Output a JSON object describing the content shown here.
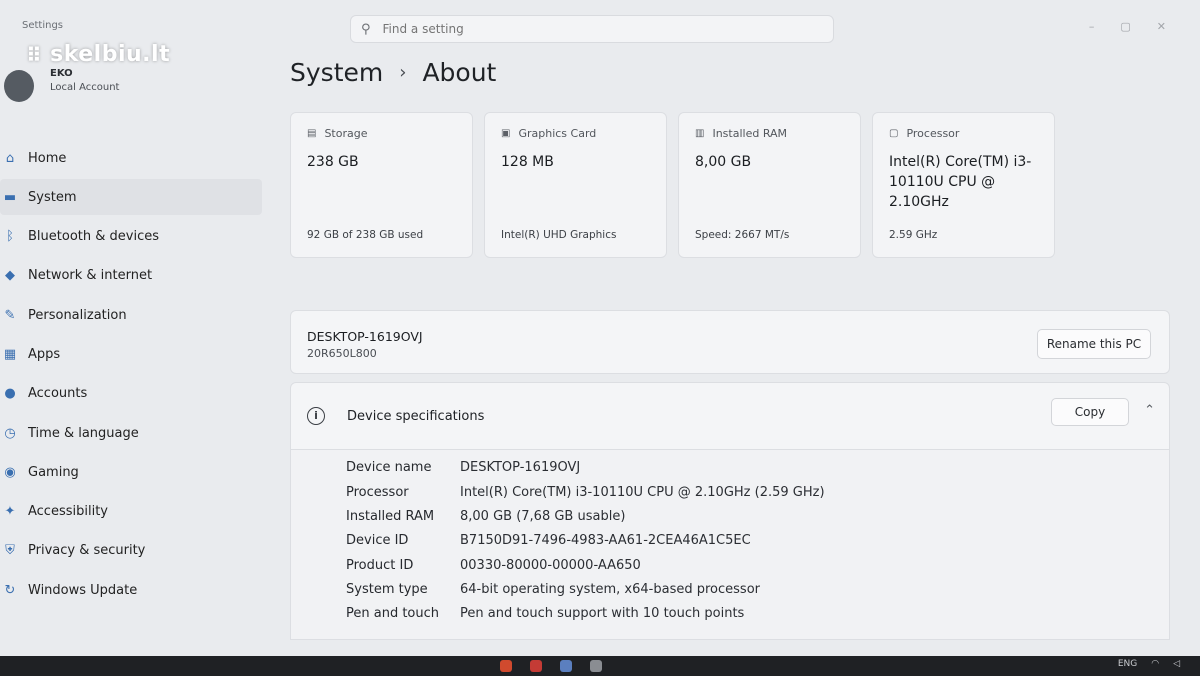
{
  "app": {
    "title": "Settings",
    "watermark": "skelbiu.lt",
    "window_controls": [
      "–",
      "▢",
      "✕"
    ]
  },
  "search": {
    "placeholder": "Find a setting"
  },
  "profile": {
    "name": "EKO",
    "account_type": "Local Account"
  },
  "nav": {
    "items": [
      {
        "label": "Home",
        "icon": "home-icon"
      },
      {
        "label": "System",
        "icon": "system-icon",
        "active": true
      },
      {
        "label": "Bluetooth & devices",
        "icon": "bluetooth-icon"
      },
      {
        "label": "Network & internet",
        "icon": "network-icon"
      },
      {
        "label": "Personalization",
        "icon": "brush-icon"
      },
      {
        "label": "Apps",
        "icon": "apps-icon"
      },
      {
        "label": "Accounts",
        "icon": "accounts-icon"
      },
      {
        "label": "Time & language",
        "icon": "clock-icon"
      },
      {
        "label": "Gaming",
        "icon": "gaming-icon"
      },
      {
        "label": "Accessibility",
        "icon": "accessibility-icon"
      },
      {
        "label": "Privacy & security",
        "icon": "shield-icon"
      },
      {
        "label": "Windows Update",
        "icon": "update-icon"
      }
    ]
  },
  "breadcrumb": {
    "parent": "System",
    "separator": "›",
    "current": "About"
  },
  "cards": [
    {
      "label": "Storage",
      "icon": "storage-icon",
      "value": "238 GB",
      "detail": "92 GB of 238 GB used"
    },
    {
      "label": "Graphics Card",
      "icon": "graphics-card-icon",
      "value": "128 MB",
      "detail": "Intel(R) UHD Graphics"
    },
    {
      "label": "Installed RAM",
      "icon": "ram-icon",
      "value": "8,00 GB",
      "detail": "Speed: 2667 MT/s"
    },
    {
      "label": "Processor",
      "icon": "processor-icon",
      "value": "Intel(R) Core(TM) i3-10110U CPU @ 2.10GHz",
      "detail": "2.59 GHz"
    }
  ],
  "pc": {
    "name": "DESKTOP-1619OVJ",
    "model": "20R650L800",
    "rename_label": "Rename this PC"
  },
  "specs": {
    "title": "Device specifications",
    "copy_label": "Copy",
    "rows": [
      {
        "key": "Device name",
        "value": "DESKTOP-1619OVJ"
      },
      {
        "key": "Processor",
        "value": "Intel(R) Core(TM) i3-10110U CPU @ 2.10GHz (2.59 GHz)"
      },
      {
        "key": "Installed RAM",
        "value": "8,00 GB (7,68 GB usable)"
      },
      {
        "key": "Device ID",
        "value": "B7150D91-7496-4983-AA61-2CEA46A1C5EC"
      },
      {
        "key": "Product ID",
        "value": "00330-80000-00000-AA650"
      },
      {
        "key": "System type",
        "value": "64-bit operating system, x64-based processor"
      },
      {
        "key": "Pen and touch",
        "value": "Pen and touch support with 10 touch points"
      }
    ]
  },
  "taskbar": {
    "lang": "ENG"
  },
  "colors": {
    "accent": "#3a6fb0",
    "active_nav": "#dfe1e5"
  }
}
